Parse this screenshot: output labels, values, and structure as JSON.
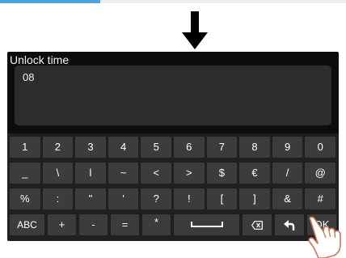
{
  "progress": 0.29,
  "dialog": {
    "title": "Unlock time",
    "input_value": "08"
  },
  "keyboard": {
    "rows": [
      [
        "1",
        "2",
        "3",
        "4",
        "5",
        "6",
        "7",
        "8",
        "9",
        "0"
      ],
      [
        "_",
        "\\",
        "l",
        "~",
        "<",
        ">",
        "$",
        "€",
        "/",
        "@"
      ],
      [
        "%",
        ":",
        "\"",
        "'",
        "?",
        "!",
        "[",
        "]",
        "&",
        "#"
      ]
    ],
    "bottom": {
      "abc": "ABC",
      "plus": "+",
      "minus": "-",
      "equals": "=",
      "star": "*",
      "ok": "OK"
    }
  },
  "icons": [
    "down-arrow-icon",
    "space-icon",
    "backspace-icon",
    "undo-icon",
    "pointing-hand-icon"
  ],
  "colors": {
    "screen_bg": "#0d0d0d",
    "input_bg": "#2c2c2c",
    "key_bg": "#3c3c3c",
    "accent": "#4aa3df"
  }
}
